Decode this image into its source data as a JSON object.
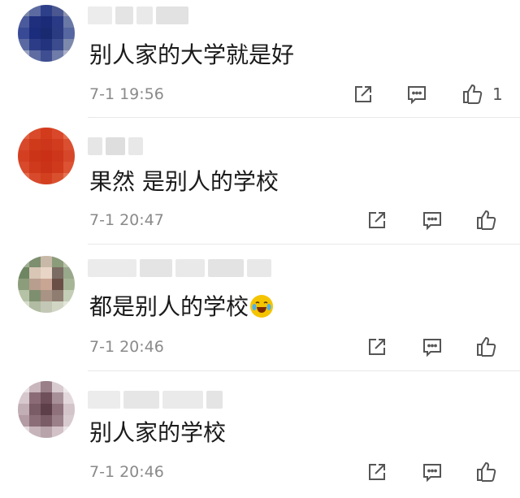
{
  "comments": [
    {
      "text": "别人家的大学就是好",
      "time": "7-1 19:56",
      "likes": "1",
      "avatar_colors": [
        "#7b87a8",
        "#5b6aa0",
        "#2e3f8a",
        "#4a5790",
        "#8c94b0",
        "#4b5a9c",
        "#1f2f7e",
        "#1b2b78",
        "#2a3a85",
        "#6a78a5",
        "#384a95",
        "#1c2c7c",
        "#1a2a70",
        "#2b3b82",
        "#5666a0",
        "#5a69a2",
        "#2d3c86",
        "#23337d",
        "#3b4b8e",
        "#7d88ad",
        "#9aa2c0",
        "#5e6ca2",
        "#3f4e90",
        "#6f7ba8",
        "#aab0c8"
      ]
    },
    {
      "text": "果然 是别人的学校",
      "time": "7-1 20:47",
      "likes": "",
      "avatar_colors": [
        "#e06040",
        "#d94a2a",
        "#d33b1d",
        "#d9482a",
        "#e46a4a",
        "#d8482a",
        "#cf3a1b",
        "#cd361a",
        "#d13c1e",
        "#da4f30",
        "#d43f21",
        "#cc3418",
        "#c93016",
        "#cd361a",
        "#d6472a",
        "#d9492b",
        "#cf3a1c",
        "#cb3318",
        "#d03a1c",
        "#dc5232",
        "#e4684a",
        "#d74a2c",
        "#d2401f",
        "#d9502f",
        "#e57455"
      ]
    },
    {
      "text": "都是别人的学校",
      "time": "7-1 20:46",
      "likes": "",
      "avatar_colors": [
        "#9fae92",
        "#7d8f6e",
        "#c8b8a8",
        "#8a9c7a",
        "#b8c2a8",
        "#6f8662",
        "#d9c6b5",
        "#e8d5c5",
        "#7a6b63",
        "#98a88a",
        "#8c9d7c",
        "#b89e8e",
        "#c9a594",
        "#6a4f47",
        "#a7b597",
        "#b6c2a6",
        "#7e8f70",
        "#a89384",
        "#8f7d72",
        "#c4cdb6",
        "#d6dccb",
        "#b1bca2",
        "#c3c7b5",
        "#d0d6c3",
        "#e2e6da"
      ]
    },
    {
      "text": "别人家的学校",
      "time": "7-1 20:46",
      "likes": "",
      "avatar_colors": [
        "#e9e2e4",
        "#c9b7bd",
        "#9a7f88",
        "#d8cbd0",
        "#efe9eb",
        "#d6c8cd",
        "#8b6c76",
        "#6f4f5a",
        "#a89099",
        "#e3d9dd",
        "#c2aeb5",
        "#7a5c66",
        "#5c3f49",
        "#8e717b",
        "#d3c4ca",
        "#b39ca4",
        "#8a6d77",
        "#795c66",
        "#9c8089",
        "#d8cbd0",
        "#e4dadd",
        "#c6b4ba",
        "#b8a3aa",
        "#d2c2c8",
        "#ece5e8"
      ]
    }
  ],
  "icons": {
    "share": "share-icon",
    "reply": "comment-icon",
    "like": "thumbs-up-icon",
    "emoji": "laughing-crying-emoji-icon"
  },
  "colors": {
    "time": "#8a8a8a",
    "icon": "#555555",
    "divider": "#e8e8e8"
  }
}
